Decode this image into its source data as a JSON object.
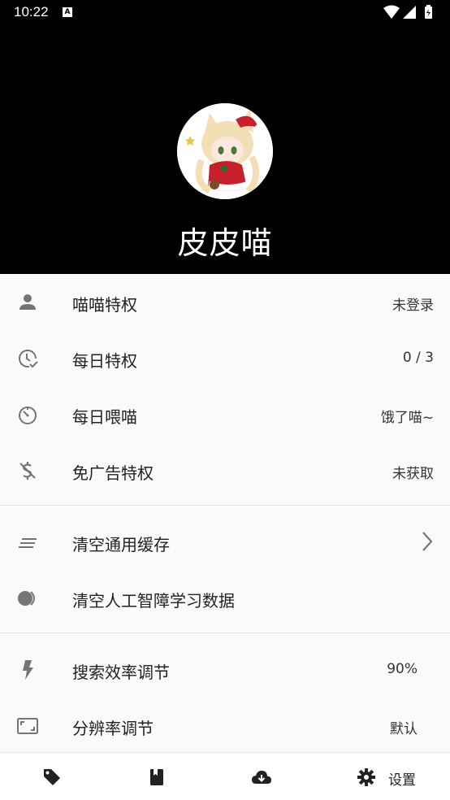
{
  "status_bar": {
    "time": "10:22",
    "notification_icon": "A"
  },
  "profile": {
    "username": "皮皮喵"
  },
  "group1": [
    {
      "icon": "person-icon",
      "label": "喵喵特权",
      "value": "未登录"
    },
    {
      "icon": "clock-check-icon",
      "label": "每日特权",
      "value": "0 / 3"
    },
    {
      "icon": "timer-icon",
      "label": "每日喂喵",
      "value": "饿了喵~"
    },
    {
      "icon": "money-off-icon",
      "label": "免广告特权",
      "value": "未获取"
    }
  ],
  "group2": [
    {
      "icon": "notes-icon",
      "label": "清空通用缓存"
    },
    {
      "icon": "toggle-icon",
      "label": "清空人工智障学习数据"
    }
  ],
  "group3": [
    {
      "icon": "bolt-icon",
      "label": "搜索效率调节",
      "value": "90%"
    },
    {
      "icon": "aspect-ratio-icon",
      "label": "分辨率调节",
      "value": "默认"
    }
  ],
  "bottom_nav": {
    "items": [
      {
        "icon": "tag-icon"
      },
      {
        "icon": "book-icon"
      },
      {
        "icon": "cloud-download-icon"
      },
      {
        "icon": "settings-icon",
        "label": "设置"
      }
    ]
  }
}
